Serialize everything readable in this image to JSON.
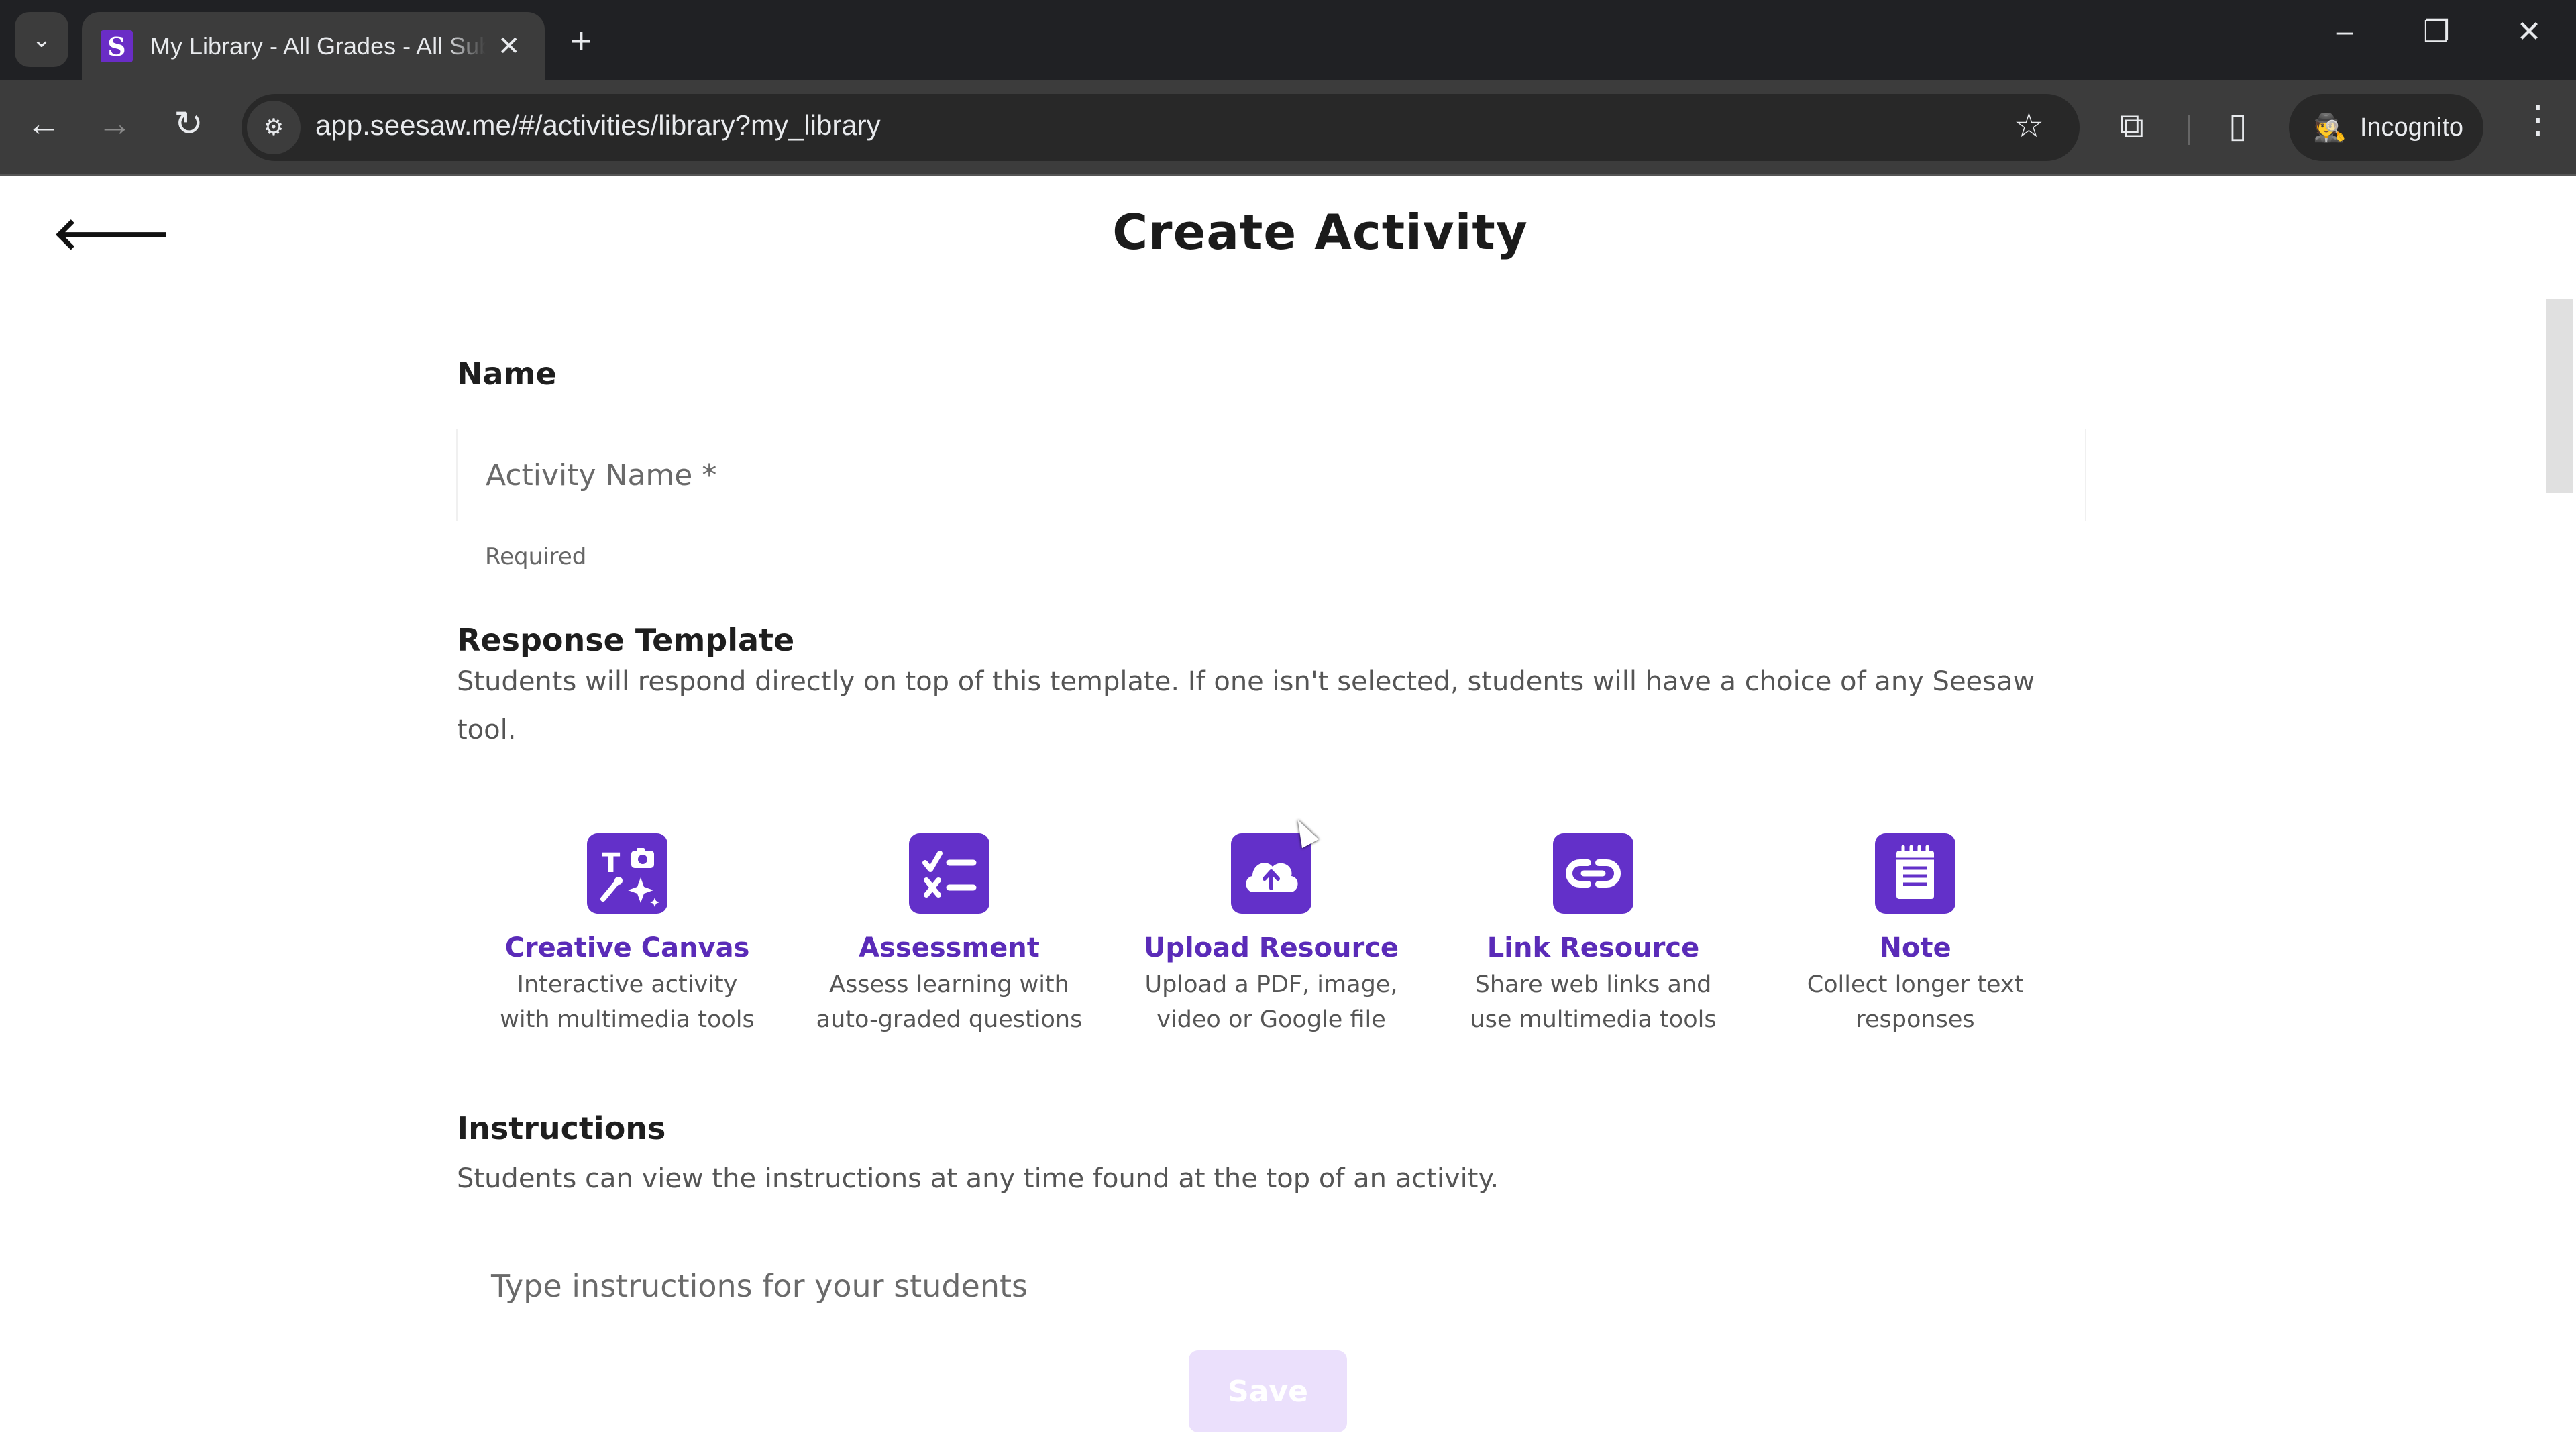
{
  "browser": {
    "tab_title": "My Library - All Grades - All Subjects",
    "favicon_letter": "S",
    "url": "app.seesaw.me/#/activities/library?my_library",
    "incognito_label": "Incognito",
    "icons": {
      "tab_search": "⌄",
      "tab_close": "✕",
      "new_tab": "+",
      "minimize": "–",
      "restore": "❐",
      "close": "✕",
      "back": "←",
      "forward": "→",
      "reload": "↻",
      "site_info": "⚙",
      "bookmark": "☆",
      "extensions": "⧉",
      "side_panel": "▯",
      "incognito": "🕵",
      "menu": "⋮"
    }
  },
  "page": {
    "back_icon": "🡐",
    "title": "Create Activity",
    "name_section": {
      "label": "Name",
      "placeholder": "Activity Name *",
      "value": "",
      "helper": "Required"
    },
    "response_template": {
      "title": "Response Template",
      "description": "Students will respond directly on top of this template. If one isn't selected, students will have a choice of any Seesaw tool.",
      "options": [
        {
          "id": "creative-canvas",
          "title": "Creative Canvas",
          "description": "Interactive activity\nwith multimedia tools",
          "icon": "creative-canvas-icon"
        },
        {
          "id": "assessment",
          "title": "Assessment",
          "description": "Assess learning with\nauto-graded questions",
          "icon": "checklist-icon"
        },
        {
          "id": "upload-resource",
          "title": "Upload Resource",
          "description": "Upload a PDF, image,\nvideo or Google file",
          "icon": "cloud-upload-icon"
        },
        {
          "id": "link-resource",
          "title": "Link Resource",
          "description": "Share web links and\nuse multimedia tools",
          "icon": "link-icon"
        },
        {
          "id": "note",
          "title": "Note",
          "description": "Collect longer text\nresponses",
          "icon": "notepad-icon"
        }
      ]
    },
    "instructions": {
      "title": "Instructions",
      "description": "Students can view the instructions at any time found at the top of an activity.",
      "placeholder": "Type instructions for your students",
      "value": ""
    },
    "save_label": "Save"
  },
  "colors": {
    "brand_purple": "#6330c9",
    "link_purple": "#5a2bb8",
    "save_disabled_bg": "#ebe0fc"
  }
}
